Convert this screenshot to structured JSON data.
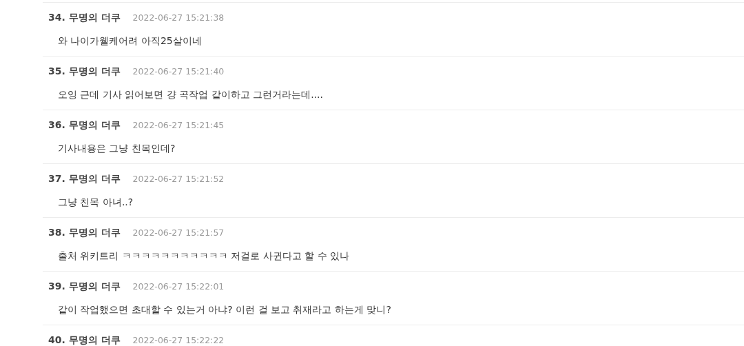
{
  "comments": [
    {
      "number": "34.",
      "author": "무명의 더쿠",
      "time": "2022-06-27 15:21:38",
      "text": "와 나이가웰케어려 아직25살이네"
    },
    {
      "number": "35.",
      "author": "무명의 더쿠",
      "time": "2022-06-27 15:21:40",
      "text": "오잉 근데 기사 읽어보면 걍 곡작업 같이하고 그런거라는데...."
    },
    {
      "number": "36.",
      "author": "무명의 더쿠",
      "time": "2022-06-27 15:21:45",
      "text": "기사내용은 그냥 친목인데?"
    },
    {
      "number": "37.",
      "author": "무명의 더쿠",
      "time": "2022-06-27 15:21:52",
      "text": "그냥 친목 아녀..?"
    },
    {
      "number": "38.",
      "author": "무명의 더쿠",
      "time": "2022-06-27 15:21:57",
      "text": "출처 위키트리 ㅋㅋㅋㅋㅋㅋㅋㅋㅋㅋㅋ 저걸로 사귄다고 할 수 있나"
    },
    {
      "number": "39.",
      "author": "무명의 더쿠",
      "time": "2022-06-27 15:22:01",
      "text": "같이 작업했으면 초대할 수 있는거 아냐? 이런 걸 보고 취재라고 하는게 맞니?"
    },
    {
      "number": "40.",
      "author": "무명의 더쿠",
      "time": "2022-06-27 15:22:22"
    }
  ]
}
